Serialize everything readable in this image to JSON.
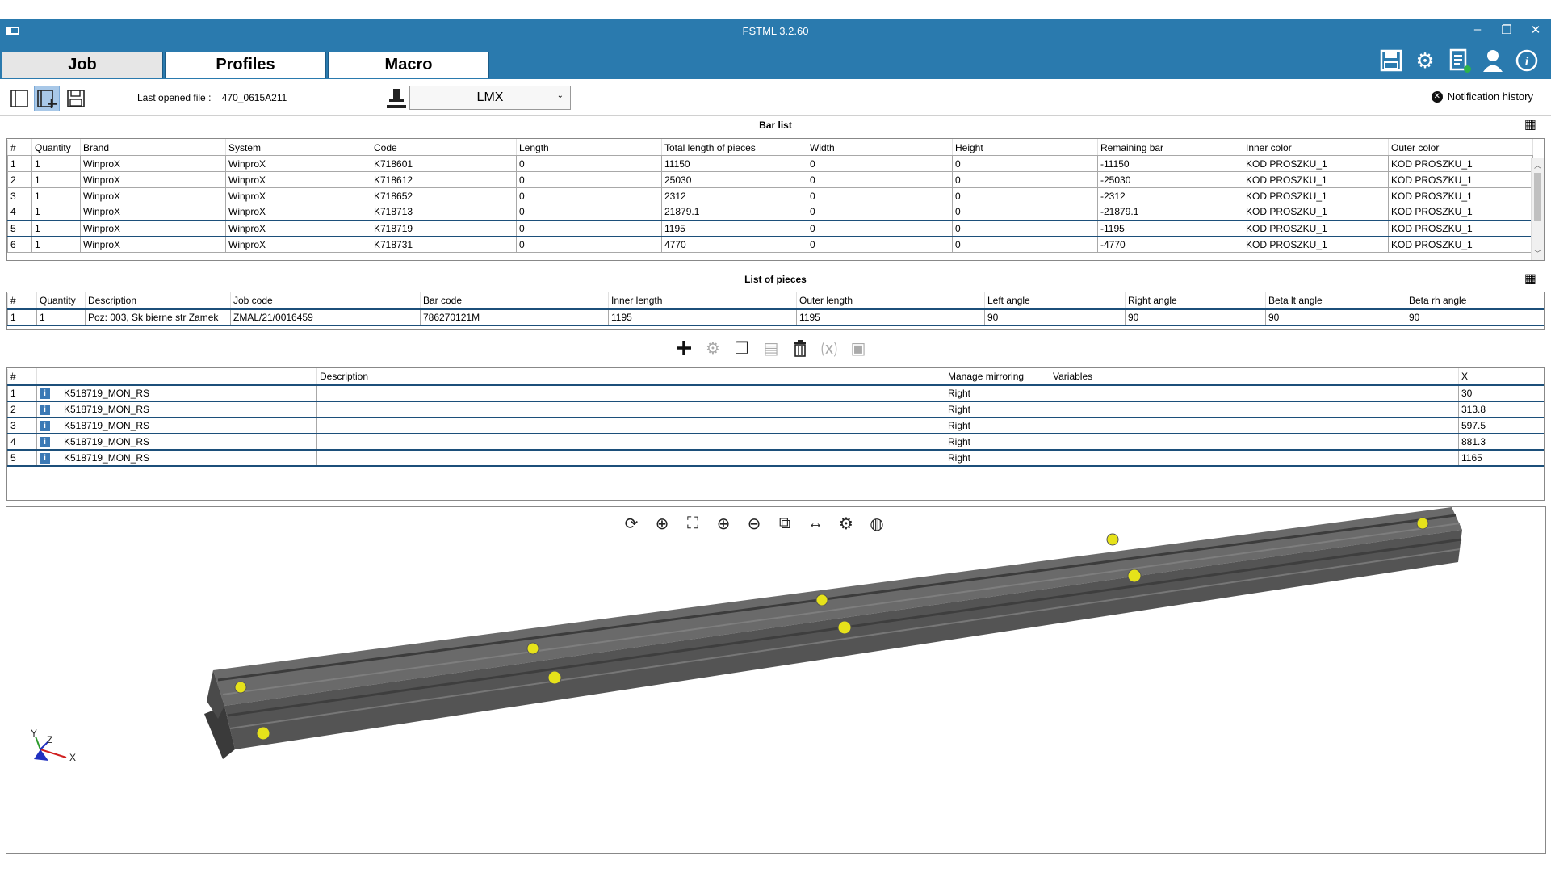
{
  "window": {
    "title": "FSTML 3.2.60",
    "controls": [
      "–",
      "❐",
      "✕"
    ]
  },
  "tabs": [
    {
      "label": "Job",
      "active": true
    },
    {
      "label": "Profiles",
      "active": false
    },
    {
      "label": "Macro",
      "active": false
    }
  ],
  "header_icons": [
    "save-disk-icon",
    "gear-icon",
    "report-icon",
    "user-icon",
    "info-icon"
  ],
  "toolbar": {
    "last_file_label": "Last opened file :",
    "last_file_value": "470_0615A211",
    "machine": "LMX",
    "notification_label": "Notification history"
  },
  "bar_list": {
    "title": "Bar list",
    "columns": [
      "#",
      "Quantity",
      "Brand",
      "System",
      "Code",
      "Length",
      "Total length of pieces",
      "Width",
      "Height",
      "Remaining bar",
      "Inner color",
      "Outer color"
    ],
    "rows": [
      [
        "1",
        "1",
        "WinproX",
        "WinproX",
        "K718601",
        "0",
        "11150",
        "0",
        "0",
        "-11150",
        "KOD PROSZKU_1",
        "KOD PROSZKU_1"
      ],
      [
        "2",
        "1",
        "WinproX",
        "WinproX",
        "K718612",
        "0",
        "25030",
        "0",
        "0",
        "-25030",
        "KOD PROSZKU_1",
        "KOD PROSZKU_1"
      ],
      [
        "3",
        "1",
        "WinproX",
        "WinproX",
        "K718652",
        "0",
        "2312",
        "0",
        "0",
        "-2312",
        "KOD PROSZKU_1",
        "KOD PROSZKU_1"
      ],
      [
        "4",
        "1",
        "WinproX",
        "WinproX",
        "K718713",
        "0",
        "21879.1",
        "0",
        "0",
        "-21879.1",
        "KOD PROSZKU_1",
        "KOD PROSZKU_1"
      ],
      [
        "5",
        "1",
        "WinproX",
        "WinproX",
        "K718719",
        "0",
        "1195",
        "0",
        "0",
        "-1195",
        "KOD PROSZKU_1",
        "KOD PROSZKU_1"
      ],
      [
        "6",
        "1",
        "WinproX",
        "WinproX",
        "K718731",
        "0",
        "4770",
        "0",
        "0",
        "-4770",
        "KOD PROSZKU_1",
        "KOD PROSZKU_1"
      ]
    ],
    "selected_row": 4
  },
  "pieces": {
    "title": "List of pieces",
    "columns": [
      "#",
      "Quantity",
      "Description",
      "Job code",
      "Bar code",
      "Inner length",
      "Outer length",
      "Left angle",
      "Right angle",
      "Beta lt angle",
      "Beta rh angle"
    ],
    "rows": [
      [
        "1",
        "1",
        "Poz: 003, Sk bierne str Zamek",
        "ZMAL/21/0016459",
        "786270121M",
        "1195",
        "1195",
        "90",
        "90",
        "90",
        "90"
      ]
    ]
  },
  "macros": {
    "columns": [
      "#",
      "",
      "",
      "Description",
      "Manage mirroring",
      "Variables",
      "X"
    ],
    "rows": [
      [
        "1",
        "K518719_MON_RS",
        "",
        "Right",
        "",
        "30"
      ],
      [
        "2",
        "K518719_MON_RS",
        "",
        "Right",
        "",
        "313.8"
      ],
      [
        "3",
        "K518719_MON_RS",
        "",
        "Right",
        "",
        "597.5"
      ],
      [
        "4",
        "K518719_MON_RS",
        "",
        "Right",
        "",
        "881.3"
      ],
      [
        "5",
        "K518719_MON_RS",
        "",
        "Right",
        "",
        "1165"
      ]
    ]
  },
  "axes": {
    "x": "X",
    "y": "Y",
    "z": "Z"
  },
  "colors": {
    "titlebar": "#2a7aae",
    "profile": "#5c5c5c",
    "marker": "#e6e21a"
  }
}
